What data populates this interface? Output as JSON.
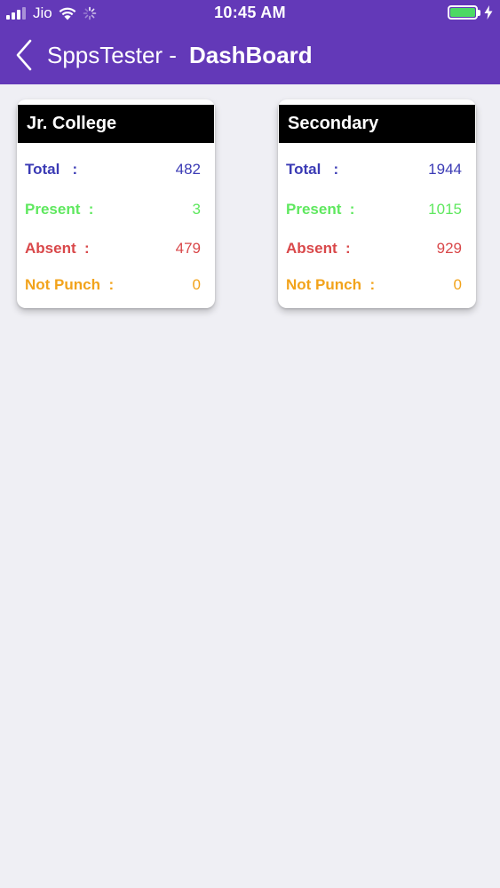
{
  "status_bar": {
    "carrier": "Jio",
    "time": "10:45 AM",
    "battery_level": 1.0
  },
  "nav": {
    "app_name": "SppsTester -",
    "page_title": "DashBoard"
  },
  "colors": {
    "header_bg": "#6339b8",
    "page_bg": "#efeff4",
    "card_header_bg": "#000000",
    "total": "#3b3bb5",
    "present": "#5fe85f",
    "absent": "#d9484a",
    "not_punch": "#f2a31b",
    "battery": "#4cd964"
  },
  "icons": {
    "back": "chevron-left-icon",
    "signal": "cellular-signal-icon",
    "wifi": "wifi-icon",
    "loading": "activity-spinner-icon",
    "battery": "battery-icon",
    "charging": "charging-bolt-icon"
  },
  "cards": [
    {
      "title": "Jr. College",
      "total_label": "Total   :",
      "total": "482",
      "present_label": "Present  :",
      "present": "3",
      "absent_label": "Absent  :",
      "absent": "479",
      "not_punch_label": "Not Punch  :",
      "not_punch": "0"
    },
    {
      "title": "Secondary",
      "total_label": "Total   :",
      "total": "1944",
      "present_label": "Present  :",
      "present": "1015",
      "absent_label": "Absent  :",
      "absent": "929",
      "not_punch_label": "Not Punch  :",
      "not_punch": "0"
    }
  ]
}
